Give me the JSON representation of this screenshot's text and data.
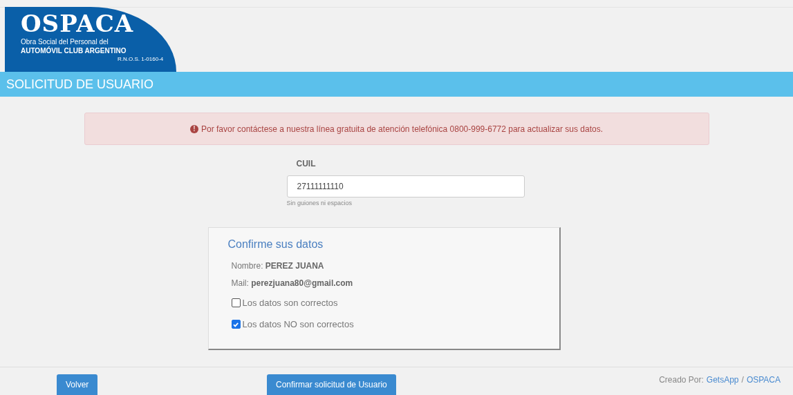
{
  "logo": {
    "title": "OSPACA",
    "subtitle": "Obra Social del Personal del",
    "org": "AUTOMÓVIL CLUB ARGENTINO",
    "rnos": "R.N.O.S. 1-0160-4"
  },
  "page_title": "SOLICITUD DE USUARIO",
  "alert": {
    "icon": "!",
    "text": "Por favor contáctese a nuestra línea gratuita de atención telefónica 0800-999-6772 para actualizar sus datos."
  },
  "cuil": {
    "label": "CUIL",
    "value": "27111111110",
    "help": "Sin guiones ni espacios"
  },
  "confirm": {
    "title": "Confirme sus datos",
    "fields": [
      {
        "label": "Nombre:",
        "value": "PEREZ JUANA"
      },
      {
        "label": "Mail:",
        "value": "perezjuana80@gmail.com"
      }
    ],
    "options": [
      {
        "label": "Los datos son correctos",
        "checked": false
      },
      {
        "label": "Los datos NO son correctos",
        "checked": true
      }
    ]
  },
  "buttons": {
    "back": "Volver",
    "submit": "Confirmar solicitud de Usuario"
  },
  "credits": {
    "prefix": "Creado Por:",
    "links": [
      "GetsApp",
      "OSPACA"
    ],
    "separator": "/"
  }
}
